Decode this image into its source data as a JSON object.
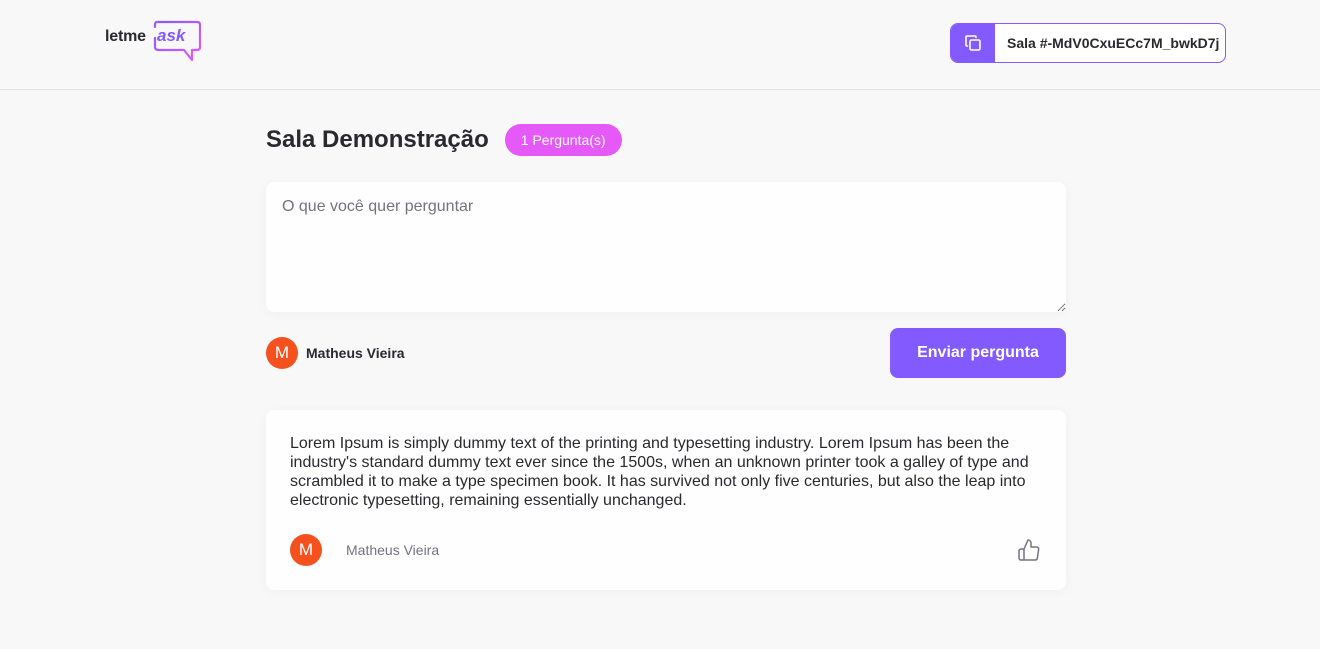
{
  "header": {
    "logo": {
      "text_main": "letme",
      "text_accent": "ask",
      "accent_color": "#835afd"
    },
    "room_code": {
      "label": "Sala #-MdV0CxuECc7M_bwkD7j",
      "icon": "copy-icon"
    }
  },
  "room": {
    "title": "Sala Demonstração",
    "question_count_badge": "1 Pergunta(s)"
  },
  "form": {
    "placeholder": "O que você quer perguntar",
    "value": "",
    "user": {
      "initial": "M",
      "name": "Matheus Vieira"
    },
    "submit_label": "Enviar pergunta"
  },
  "questions": [
    {
      "content": "Lorem Ipsum is simply dummy text of the printing and typesetting industry. Lorem Ipsum has been the industry's standard dummy text ever since the 1500s, when an unknown printer took a galley of type and scrambled it to make a type specimen book. It has survived not only five centuries, but also the leap into electronic typesetting, remaining essentially unchanged.",
      "author": {
        "initial": "M",
        "name": "Matheus Vieira"
      },
      "like_icon": "thumbs-up-icon"
    }
  ],
  "colors": {
    "primary": "#835afd",
    "badge": "#e559f9",
    "avatar": "#f4511e",
    "background": "#f8f8f8",
    "text": "#29292e",
    "muted": "#737380"
  }
}
